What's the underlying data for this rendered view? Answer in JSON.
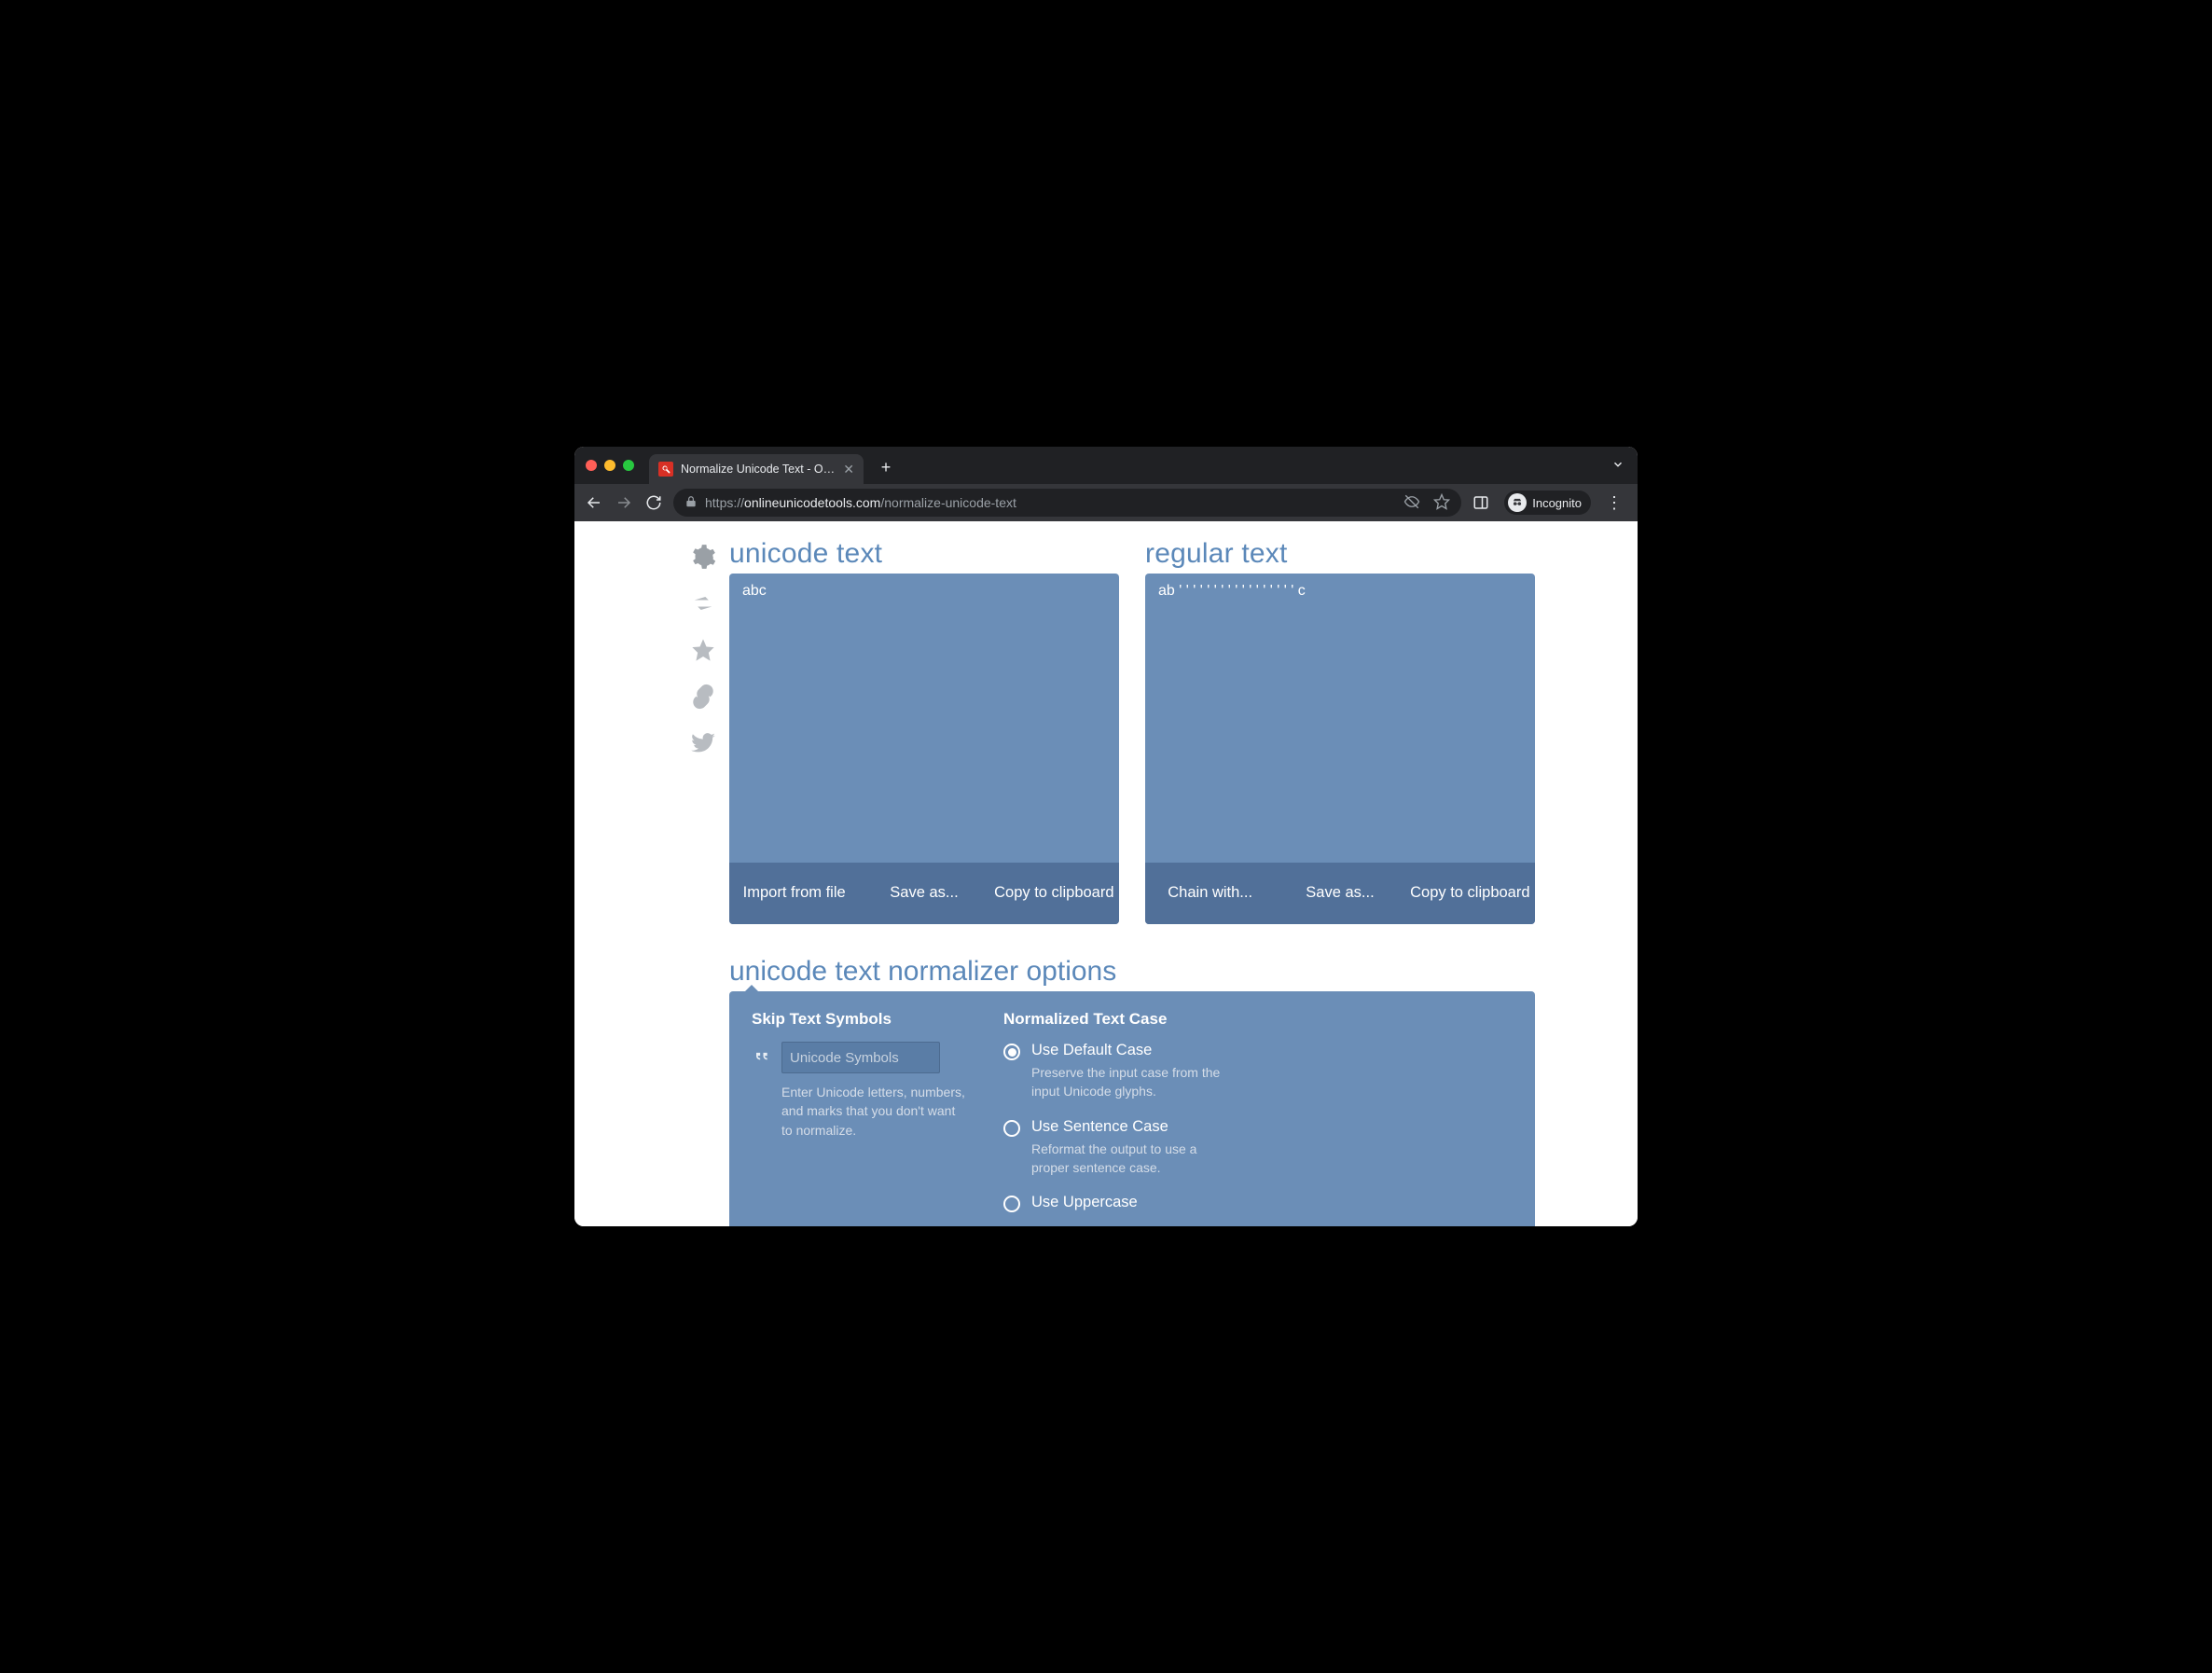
{
  "browser": {
    "tab_title": "Normalize Unicode Text - Onlin",
    "url_scheme": "https://",
    "url_host": "onlineunicodetools.com",
    "url_path": "/normalize-unicode-text",
    "incognito_label": "Incognito"
  },
  "panels": {
    "left": {
      "title": "unicode text",
      "content": "abc",
      "actions": [
        "Import from file",
        "Save as...",
        "Copy to clipboard"
      ]
    },
    "right": {
      "title": "regular text",
      "content": "ab ' ' ' ' ' ' ' ' ' ' ' ' ' ' ' ' ' c",
      "actions": [
        "Chain with...",
        "Save as...",
        "Copy to clipboard"
      ]
    }
  },
  "options": {
    "title": "unicode text normalizer options",
    "skip": {
      "heading": "Skip Text Symbols",
      "placeholder": "Unicode Symbols",
      "description": "Enter Unicode letters, numbers, and marks that you don't want to normalize."
    },
    "case": {
      "heading": "Normalized Text Case",
      "items": [
        {
          "title": "Use Default Case",
          "desc": "Preserve the input case from the input Unicode glyphs.",
          "checked": true
        },
        {
          "title": "Use Sentence Case",
          "desc": "Reformat the output to use a proper sentence case.",
          "checked": false
        },
        {
          "title": "Use Uppercase",
          "desc": "",
          "checked": false
        }
      ]
    }
  }
}
